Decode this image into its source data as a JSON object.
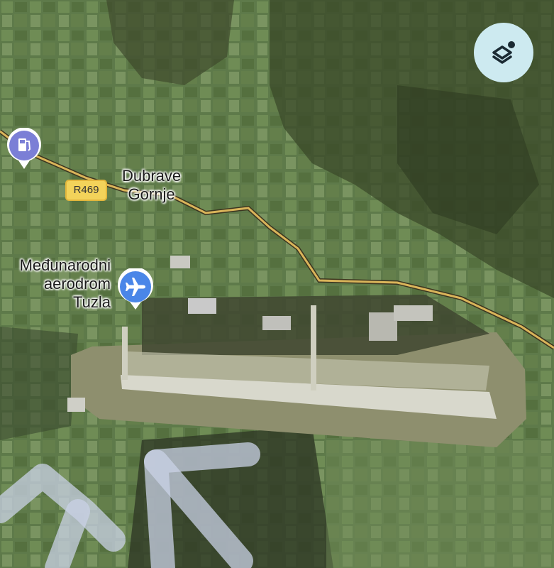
{
  "map": {
    "type": "satellite",
    "places": {
      "village": [
        "Dubrave",
        "Gornje"
      ],
      "airport": [
        "Međunarodni",
        "aerodrom",
        "Tuzla"
      ]
    },
    "road_shield": "R469",
    "pins": {
      "gas_station": "gas-station-icon",
      "airport": "airplane-icon"
    },
    "controls": {
      "layers": "layers-icon"
    },
    "colors": {
      "road": "#d9b45a",
      "pin_purple": "#7b7fd6",
      "pin_blue": "#4a86e8",
      "layers_bg": "#cdeaf0"
    }
  }
}
